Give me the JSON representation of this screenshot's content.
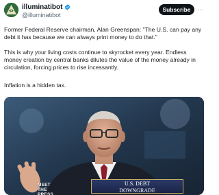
{
  "author": {
    "name": "illuminatibot",
    "handle": "@illuminatibot",
    "verified_icon": "verified-badge-icon",
    "avatar_icon": "pyramid-eye-avatar-icon"
  },
  "actions": {
    "subscribe_label": "Subscribe",
    "more_label": "···"
  },
  "post": {
    "paragraph_1": "Former Federal Reserve chairman, Alan Greenspan: \"The U.S. can pay any debt it has because we can always print money to do that.\"",
    "paragraph_2": "This is why your living costs continue to skyrocket every year. Endless money creation by central banks dilutes the value of the money already in circulation, forcing prices to rise incessantly.",
    "paragraph_3": "Inflation is a hidden tax."
  },
  "media": {
    "show_logo": "MEET THE PRESS",
    "caption_line_1": "U.S. DEBT",
    "caption_line_2": "DOWNGRADE"
  },
  "colors": {
    "verified": "#1d9bf0",
    "subscribe_bg": "#0f1419",
    "studio_bg": "#243a52"
  }
}
